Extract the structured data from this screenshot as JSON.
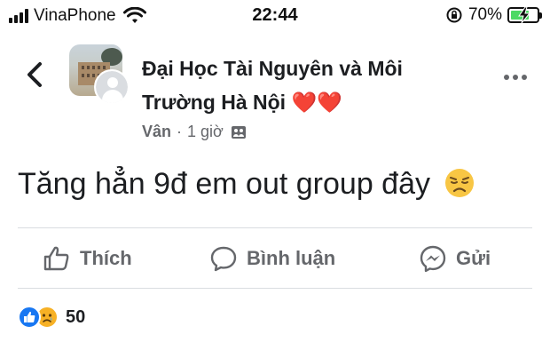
{
  "status_bar": {
    "carrier": "VinaPhone",
    "time": "22:44",
    "battery_percent": "70%",
    "battery_level": 0.7,
    "charging": true
  },
  "post": {
    "group_name": "Đại Học Tài Nguyên và Môi Trường Hà Nội",
    "group_hearts": "❤️❤️",
    "author": "Vân",
    "separator": "·",
    "time_ago": "1 giờ",
    "text": "Tăng hẳn 9đ em out group đây",
    "reaction_count": "50"
  },
  "actions": {
    "like_label": "Thích",
    "comment_label": "Bình luận",
    "send_label": "Gửi"
  },
  "icons": {
    "back": "chevron-left-icon",
    "more": "more-dots-icon",
    "privacy": "group-privacy-icon",
    "like": "thumbs-up-icon",
    "comment": "comment-bubble-icon",
    "send": "messenger-icon",
    "reaction_like": "like-reaction-icon",
    "reaction_sad": "sad-reaction-icon"
  },
  "colors": {
    "text": "#1c1e21",
    "muted": "#65676b",
    "divider": "#dadde1",
    "like_blue": "#1877f2",
    "sad_yellow": "#f7b125",
    "battery_green": "#4cd964"
  }
}
